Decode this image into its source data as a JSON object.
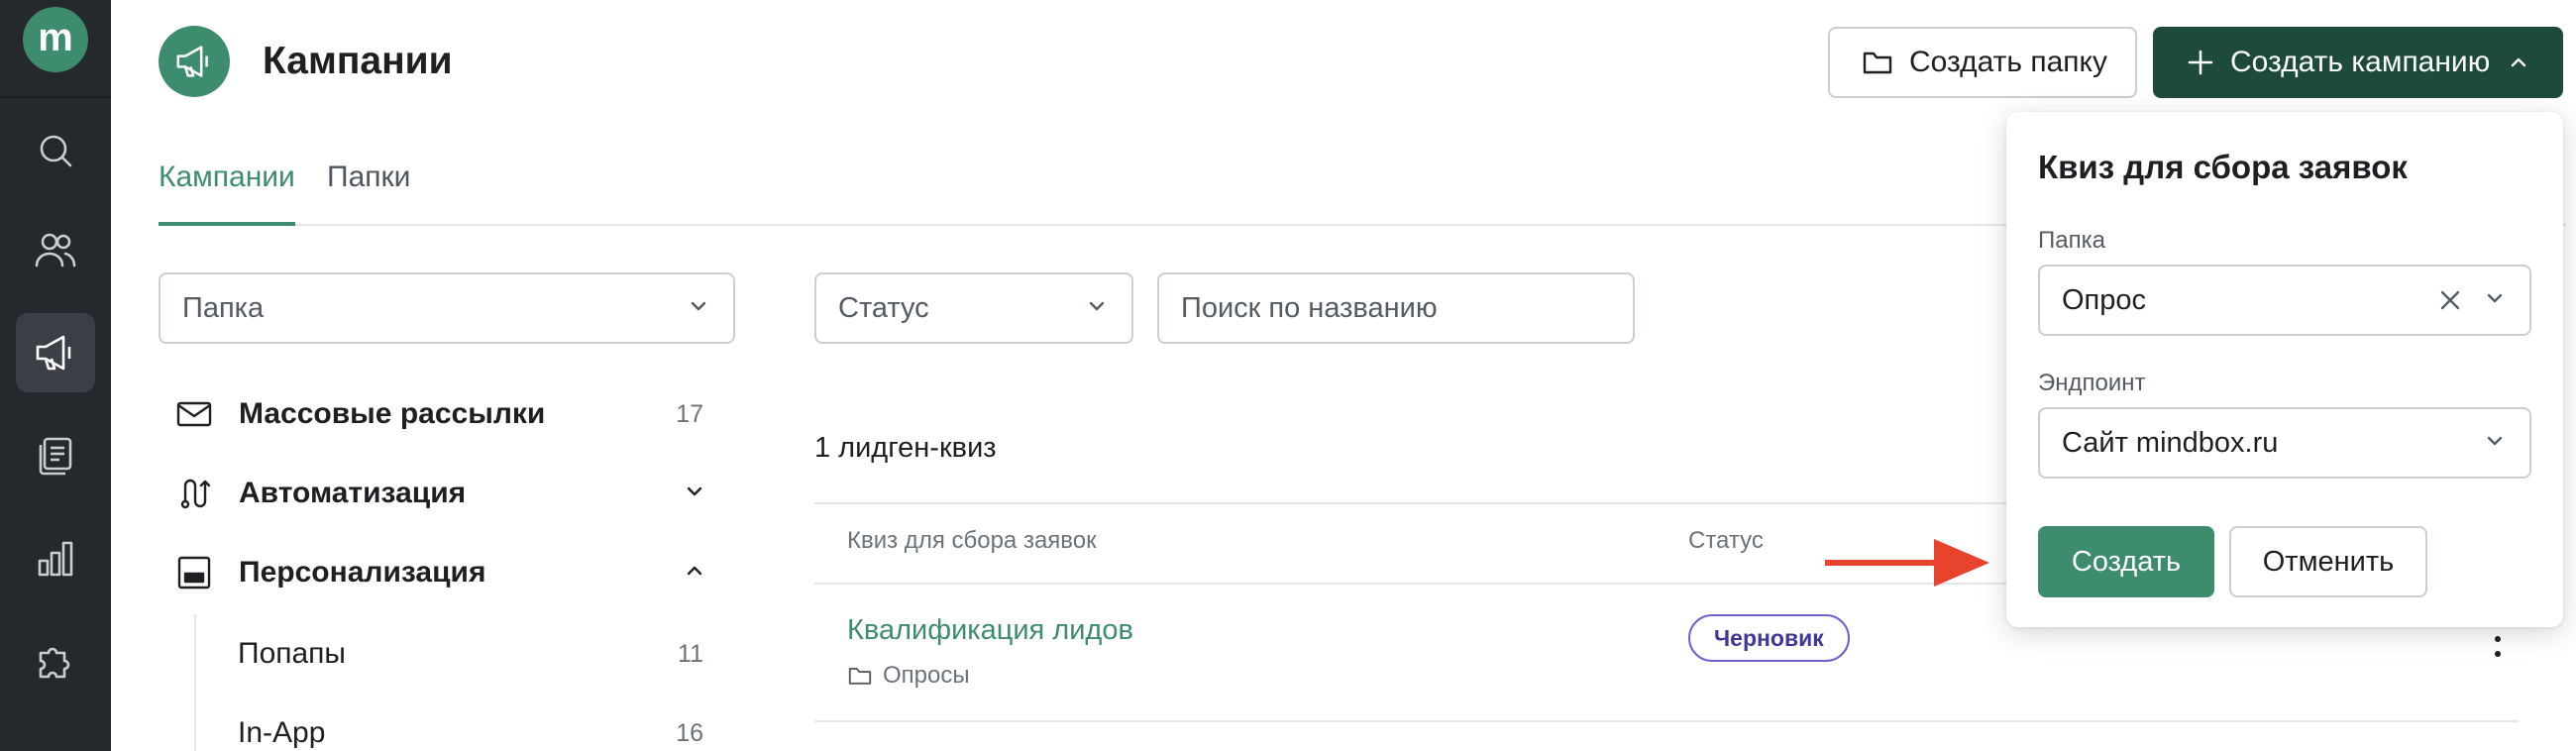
{
  "app": {
    "logo_letter": "m",
    "accent_color": "#3d8c6d",
    "dark_button_color": "#1d4a3b",
    "rail_color": "#25282c",
    "rail_icons": [
      "search-icon",
      "users-icon",
      "megaphone-icon",
      "documents-icon",
      "analytics-icon",
      "puzzle-icon"
    ],
    "rail_active": "megaphone-icon"
  },
  "header": {
    "title": "Кампании",
    "create_folder_label": "Создать папку",
    "create_campaign_label": "Создать кампанию"
  },
  "tabs": [
    {
      "label": "Кампании",
      "active": true
    },
    {
      "label": "Папки",
      "active": false
    }
  ],
  "filters": {
    "folder_placeholder": "Папка",
    "status_placeholder": "Статус",
    "search_placeholder": "Поиск по названию"
  },
  "sidebar": {
    "items": [
      {
        "label": "Массовые рассылки",
        "count": "17",
        "icon": "mail-icon"
      },
      {
        "label": "Автоматизация",
        "icon": "route-icon",
        "expanded": false
      },
      {
        "label": "Персонализация",
        "icon": "layout-icon",
        "expanded": true
      }
    ],
    "subitems": [
      {
        "label": "Попапы",
        "count": "11"
      },
      {
        "label": "In-App",
        "count": "16"
      }
    ]
  },
  "list": {
    "count_text": "1 лидген-квиз",
    "col_name": "Квиз для сбора заявок",
    "col_status": "Статус",
    "rows": [
      {
        "name": "Квалификация лидов",
        "folder": "Опросы",
        "status": "Черновик",
        "status_color": "#6b63c9"
      }
    ]
  },
  "popover": {
    "title": "Квиз для сбора заявок",
    "folder_label": "Папка",
    "folder_value": "Опрос",
    "endpoint_label": "Эндпоинт",
    "endpoint_value": "Сайт mindbox.ru",
    "create_label": "Создать",
    "cancel_label": "Отменить"
  },
  "annotation": {
    "arrow_color": "#e8432c"
  }
}
